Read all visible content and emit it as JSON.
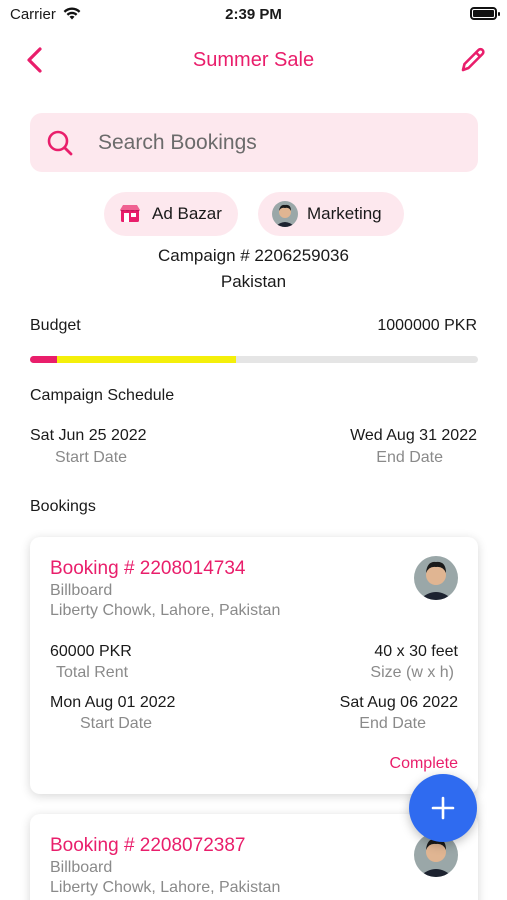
{
  "status_bar": {
    "carrier": "Carrier",
    "time": "2:39 PM"
  },
  "nav": {
    "title": "Summer Sale",
    "back_icon": "chevron-left-icon",
    "edit_icon": "pencil-icon"
  },
  "search": {
    "placeholder": "Search Bookings",
    "value": ""
  },
  "chips": [
    {
      "label": "Ad Bazar",
      "icon": "storefront-icon"
    },
    {
      "label": "Marketing",
      "icon": "avatar"
    }
  ],
  "campaign": {
    "number": "Campaign # 2206259036",
    "country": "Pakistan"
  },
  "budget": {
    "label": "Budget",
    "value": "1000000 PKR",
    "spent_fraction": 0.06,
    "booked_fraction": 0.46
  },
  "schedule": {
    "label": "Campaign Schedule",
    "start_date": "Sat Jun 25 2022",
    "start_caption": "Start Date",
    "end_date": "Wed Aug 31 2022",
    "end_caption": "End Date"
  },
  "bookings_label": "Bookings",
  "bookings": [
    {
      "title": "Booking # 2208014734",
      "type": "Billboard",
      "location": "Liberty Chowk, Lahore, Pakistan",
      "rent": "60000 PKR",
      "rent_caption": "Total Rent",
      "size": "40 x 30 feet",
      "size_caption": "Size (w x h)",
      "start_date": "Mon Aug 01 2022",
      "start_caption": "Start Date",
      "end_date": "Sat Aug 06 2022",
      "end_caption": "End Date",
      "status": "Complete"
    },
    {
      "title": "Booking # 2208072387",
      "type": "Billboard",
      "location": "Liberty Chowk, Lahore, Pakistan"
    }
  ],
  "fab": {
    "icon": "plus-icon"
  },
  "colors": {
    "accent": "#e91e6b",
    "chip_bg": "#fde8ee",
    "fab": "#2f6bf0",
    "budget_yellow": "#f4ef0a"
  }
}
